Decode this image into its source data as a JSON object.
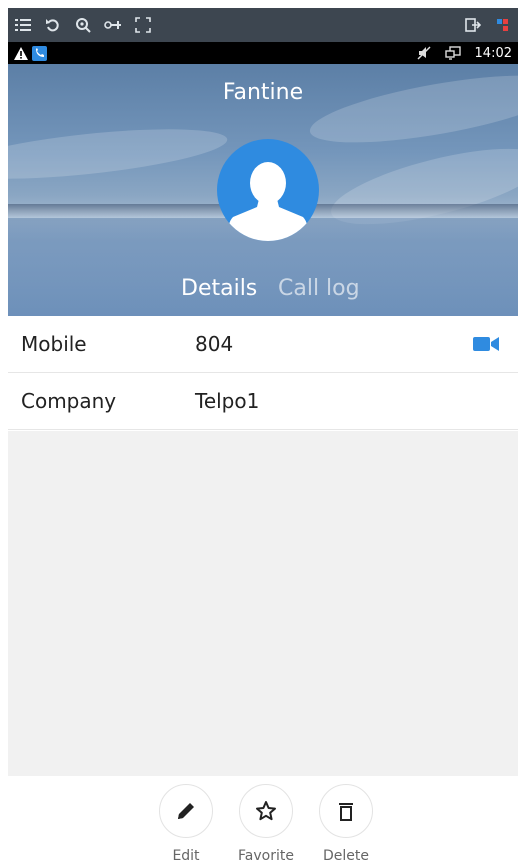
{
  "toolbar": {
    "icons": [
      "menu-list-icon",
      "undo-icon",
      "zoom-icon",
      "key-icon",
      "fullscreen-icon"
    ],
    "right_icons": [
      "exit-icon",
      "color-squares-icon"
    ]
  },
  "statusbar": {
    "left_icons": [
      "warning-icon",
      "phone-app-icon"
    ],
    "right_icons": [
      "mute-icon",
      "screen-mirror-icon"
    ],
    "time": "14:02"
  },
  "contact": {
    "name": "Fantine"
  },
  "tabs": [
    {
      "label": "Details",
      "active": true
    },
    {
      "label": "Call log",
      "active": false
    }
  ],
  "details": [
    {
      "label": "Mobile",
      "value": "804",
      "action_icon": "video-call-icon"
    },
    {
      "label": "Company",
      "value": "Telpo1"
    }
  ],
  "actions": [
    {
      "label": "Edit",
      "icon": "pencil-icon"
    },
    {
      "label": "Favorite",
      "icon": "star-icon"
    },
    {
      "label": "Delete",
      "icon": "trash-icon"
    }
  ],
  "colors": {
    "accent": "#2f8be0",
    "toolbar_bg": "#3d4650",
    "statusbar_bg": "#000000",
    "blank_area": "#f1f1f1"
  }
}
